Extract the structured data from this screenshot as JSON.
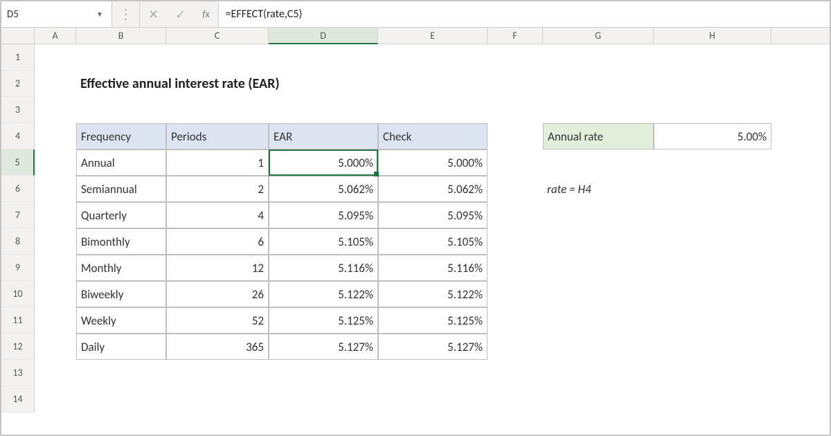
{
  "formula_bar": {
    "cell_ref": "D5",
    "formula": "=EFFECT(rate,C5)",
    "fx_label": "fx"
  },
  "columns": [
    "A",
    "B",
    "C",
    "D",
    "E",
    "F",
    "G",
    "H"
  ],
  "rows": [
    "1",
    "2",
    "3",
    "4",
    "5",
    "6",
    "7",
    "8",
    "9",
    "10",
    "11",
    "12",
    "13",
    "14"
  ],
  "title": "Effective annual interest rate (EAR)",
  "headers": {
    "b": "Frequency",
    "c": "Periods",
    "d": "EAR",
    "e": "Check"
  },
  "annual_rate_label": "Annual rate",
  "annual_rate_value": "5.00%",
  "note": "rate = H4",
  "table": [
    {
      "freq": "Annual",
      "periods": "1",
      "ear": "5.000%",
      "check": "5.000%"
    },
    {
      "freq": "Semiannual",
      "periods": "2",
      "ear": "5.062%",
      "check": "5.062%"
    },
    {
      "freq": "Quarterly",
      "periods": "4",
      "ear": "5.095%",
      "check": "5.095%"
    },
    {
      "freq": "Bimonthly",
      "periods": "6",
      "ear": "5.105%",
      "check": "5.105%"
    },
    {
      "freq": "Monthly",
      "periods": "12",
      "ear": "5.116%",
      "check": "5.116%"
    },
    {
      "freq": "Biweekly",
      "periods": "26",
      "ear": "5.122%",
      "check": "5.122%"
    },
    {
      "freq": "Weekly",
      "periods": "52",
      "ear": "5.125%",
      "check": "5.125%"
    },
    {
      "freq": "Daily",
      "periods": "365",
      "ear": "5.127%",
      "check": "5.127%"
    }
  ],
  "chart_data": {
    "type": "table",
    "title": "Effective annual interest rate (EAR)",
    "nominal_annual_rate": 0.05,
    "columns": [
      "Frequency",
      "Periods",
      "EAR",
      "Check"
    ],
    "rows": [
      {
        "Frequency": "Annual",
        "Periods": 1,
        "EAR": 0.05,
        "Check": 0.05
      },
      {
        "Frequency": "Semiannual",
        "Periods": 2,
        "EAR": 0.05062,
        "Check": 0.05062
      },
      {
        "Frequency": "Quarterly",
        "Periods": 4,
        "EAR": 0.05095,
        "Check": 0.05095
      },
      {
        "Frequency": "Bimonthly",
        "Periods": 6,
        "EAR": 0.05105,
        "Check": 0.05105
      },
      {
        "Frequency": "Monthly",
        "Periods": 12,
        "EAR": 0.05116,
        "Check": 0.05116
      },
      {
        "Frequency": "Biweekly",
        "Periods": 26,
        "EAR": 0.05122,
        "Check": 0.05122
      },
      {
        "Frequency": "Weekly",
        "Periods": 52,
        "EAR": 0.05125,
        "Check": 0.05125
      },
      {
        "Frequency": "Daily",
        "Periods": 365,
        "EAR": 0.05127,
        "Check": 0.05127
      }
    ]
  }
}
